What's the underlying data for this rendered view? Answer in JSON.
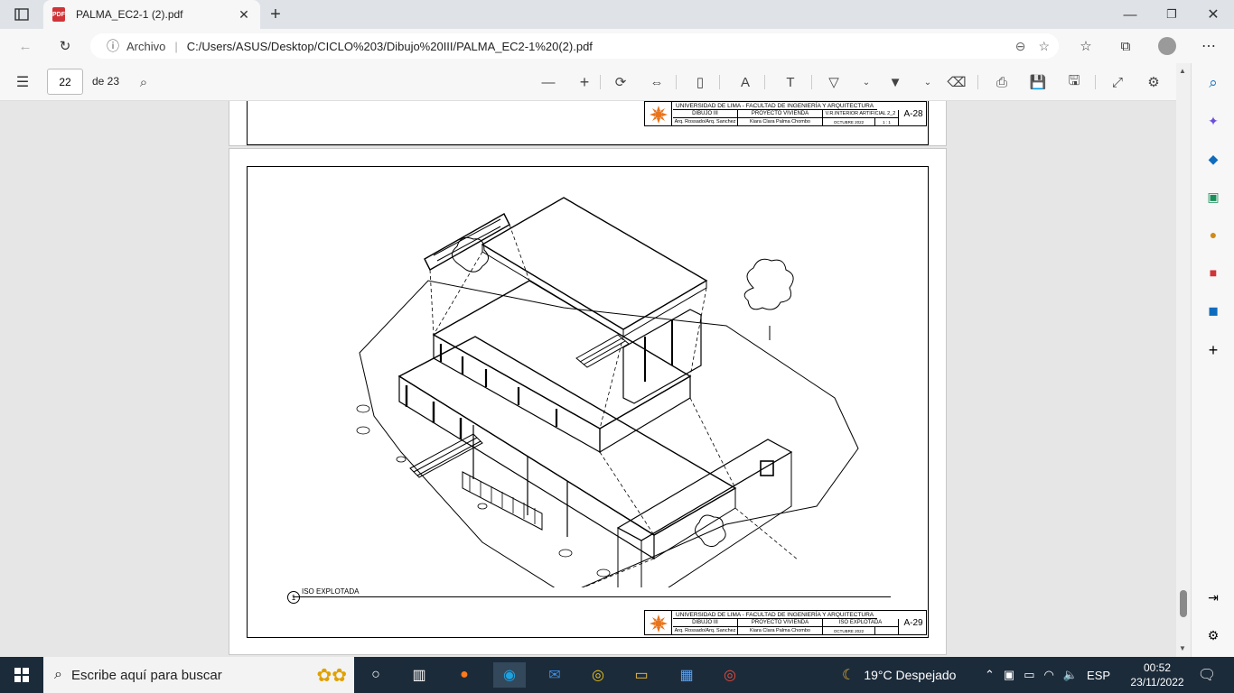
{
  "browser": {
    "tab_title": "PALMA_EC2-1 (2).pdf",
    "tab_icon_text": "PDF",
    "address_label": "Archivo",
    "url": "C:/Users/ASUS/Desktop/CICLO%203/Dibujo%20III/PALMA_EC2-1%20(2).pdf"
  },
  "pdf_toolbar": {
    "page_number": "22",
    "page_total": "de 23"
  },
  "sheet_prev": {
    "university": "UNIVERSIDAD DE LIMA - FACULTAD DE INGENIERÍA Y ARQUITECTURA",
    "course": "DIBUJO III",
    "project": "PROYECTO VIVIENDA",
    "view": "V.R.INTERIOR ARTIFICIAL 2_2",
    "professors": "Arq. Rossado/Arq. Sanchez",
    "student": "Kiara Clara Palma Chombo",
    "date": "OCTUBRE 2022",
    "scale": "1 : 1",
    "sheet": "A-28"
  },
  "sheet_main": {
    "drawing_number": "1",
    "drawing_title": "ISO EXPLOTADA",
    "university": "UNIVERSIDAD DE LIMA - FACULTAD DE INGENIERÍA Y ARQUITECTURA",
    "course": "DIBUJO III",
    "project": "PROYECTO VIVIENDA",
    "view": "ISO EXPLOTADA",
    "professors": "Arq. Rossado/Arq. Sanchez",
    "student": "Kiara Clara Palma Chombo",
    "date": "OCTUBRE 2022",
    "sheet": "A-29"
  },
  "taskbar": {
    "search_placeholder": "Escribe aquí para buscar",
    "weather": "19°C  Despejado",
    "language": "ESP",
    "time": "00:52",
    "date": "23/11/2022"
  },
  "colors": {
    "accent_red": "#d13438",
    "edge_blue": "#0f6cbd",
    "taskbar": "#1c2b3a",
    "logo_orange": "#e8741c"
  }
}
